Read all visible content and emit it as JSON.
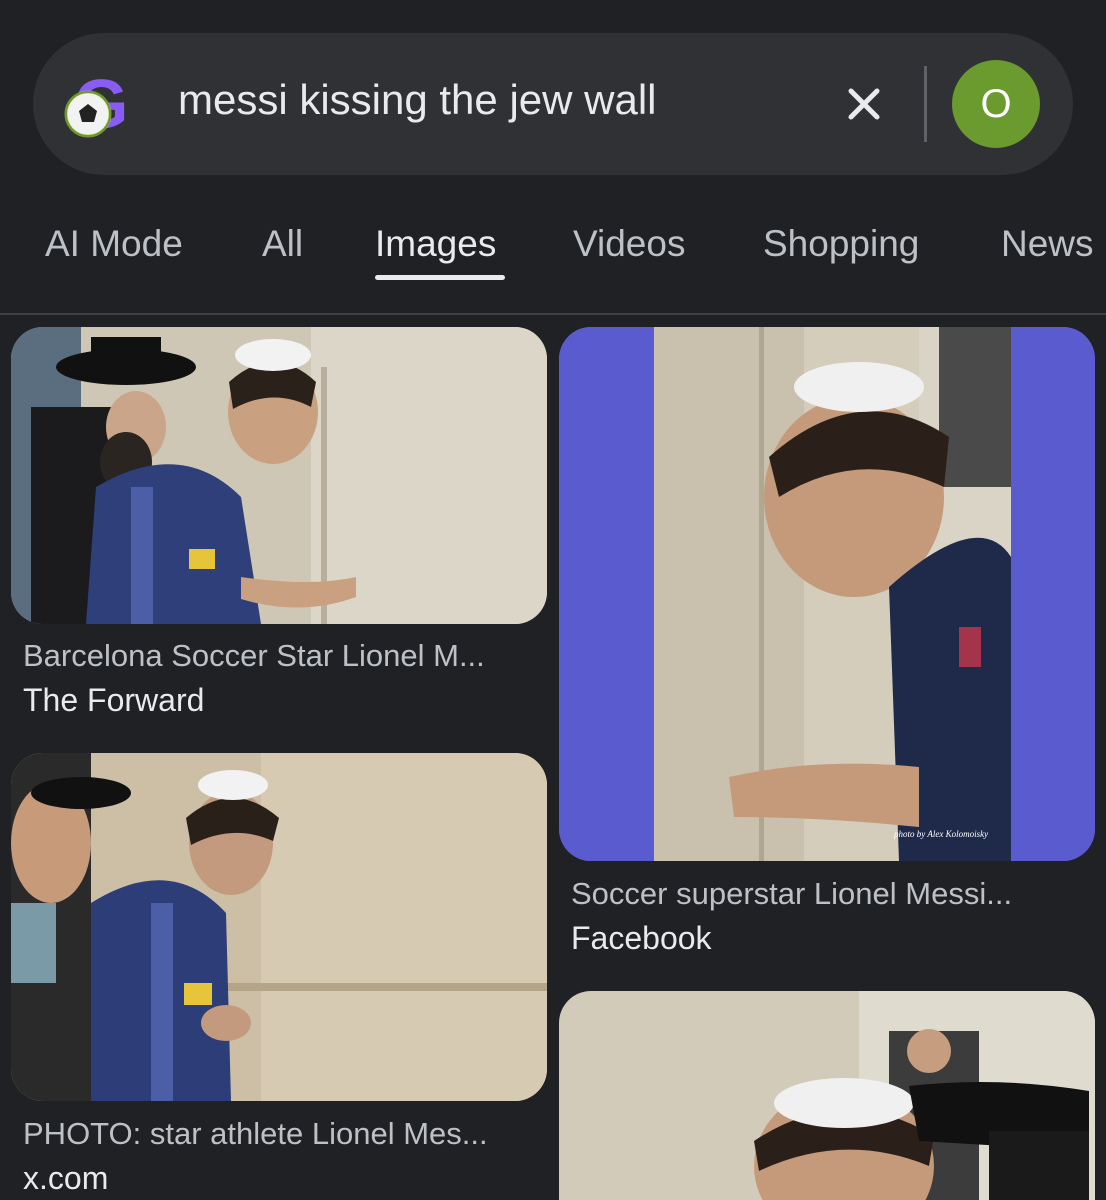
{
  "search": {
    "query": "messi kissing the jew wall",
    "avatar_letter": "O",
    "clear_icon": "close-icon"
  },
  "tabs": [
    {
      "label": "AI Mode"
    },
    {
      "label": "All"
    },
    {
      "label": "Images",
      "active": true
    },
    {
      "label": "Videos"
    },
    {
      "label": "Shopping"
    },
    {
      "label": "News"
    }
  ],
  "results": [
    {
      "caption": "Barcelona Soccer Star Lionel M...",
      "source": "The Forward"
    },
    {
      "caption": "Soccer superstar Lionel Messi...",
      "source": "Facebook",
      "photo_credit": "photo by Alex Kolomoisky"
    },
    {
      "caption": "PHOTO: star athlete Lionel Mes...",
      "source": "x.com"
    },
    {
      "caption": "",
      "source": ""
    }
  ],
  "colors": {
    "background": "#202124",
    "searchbar": "#303134",
    "avatar": "#6b9a2f",
    "frame_purple": "#5b5bd0"
  }
}
